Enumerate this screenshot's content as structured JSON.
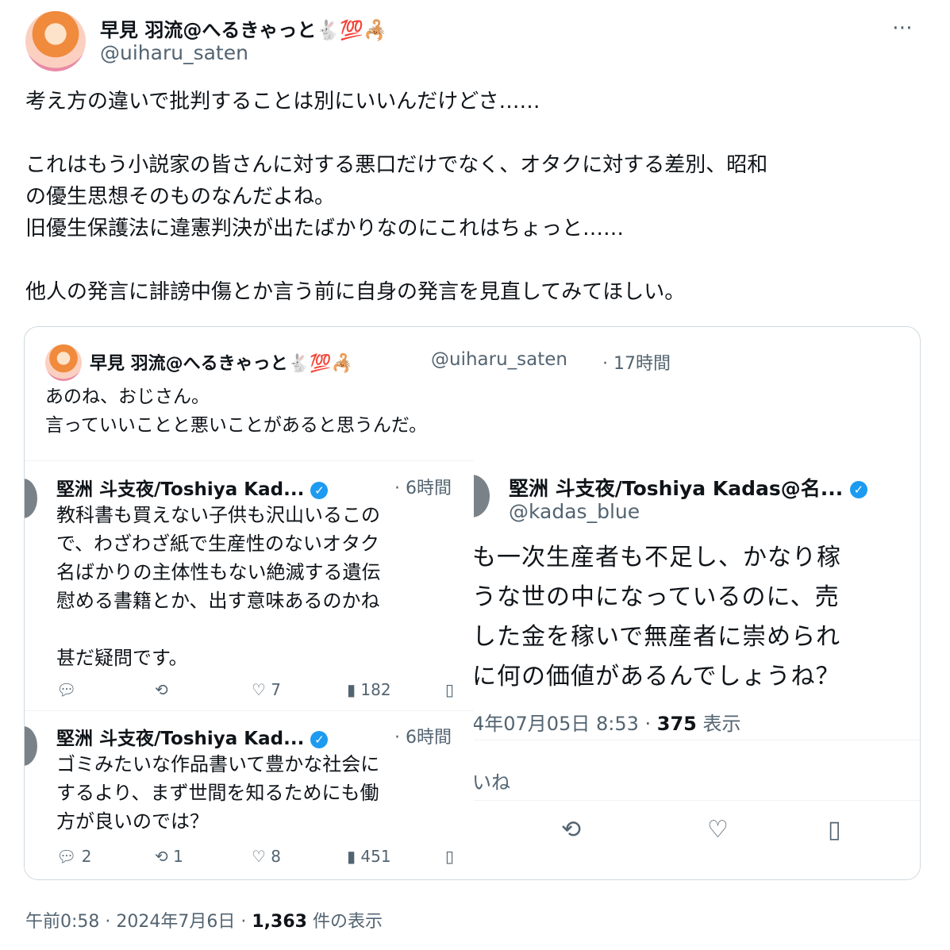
{
  "post": {
    "author_name": "早見 羽流@へるきゃっと🐇💯🦂",
    "author_handle": "@uiharu_saten",
    "more_icon": "⋯",
    "text_lines": [
      "考え方の違いで批判することは別にいいんだけどさ……",
      "",
      "これはもう小説家の皆さんに対する悪口だけでなく、オタクに対する差別、昭和",
      "の優生思想そのものなんだよね。",
      "旧優生保護法に違憲判決が出たばかりなのにこれはちょっと……",
      "",
      "他人の発言に誹謗中傷とか言う前に自身の発言を見直してみてほしい。"
    ],
    "footer": {
      "time": "午前0:58",
      "date": "2024年7月6日",
      "views_count": "1,363",
      "views_label": "件の表示"
    }
  },
  "quote": {
    "author_name": "早見 羽流@へるきゃっと🐇💯🦂",
    "author_handle": "@uiharu_saten",
    "time": "· 17時間",
    "text_lines": [
      "あのね、おじさん。",
      "言っていいことと悪いことがあると思うんだ。"
    ]
  },
  "left_panel": {
    "tweets": [
      {
        "author": "堅洲 斗支夜/Toshiya Kad...",
        "time": "· 6時間",
        "lines": [
          "教科書も買えない子供も沢山いるこの",
          "で、わざわざ紙で生産性のないオタク",
          "名ばかりの主体性もない絶滅する遺伝",
          "慰める書籍とか、出す意味あるのかね",
          "",
          "甚だ疑問です。"
        ],
        "replies": "",
        "retweets": "",
        "likes": "7",
        "views": "182"
      },
      {
        "author": "堅洲 斗支夜/Toshiya Kad...",
        "time": "· 6時間",
        "lines": [
          "ゴミみたいな作品書いて豊かな社会に",
          "するより、まず世間を知るためにも働",
          "方が良いのでは？"
        ],
        "replies": "2",
        "retweets": "1",
        "likes": "8",
        "views": "451"
      }
    ]
  },
  "right_panel": {
    "author": "堅洲 斗支夜/Toshiya Kadas@名...",
    "handle": "@kadas_blue",
    "lines": [
      "も一次生産者も不足し、かなり稼",
      "うな世の中になっているのに、売",
      "した金を稼いで無産者に崇められ",
      "に何の価値があるんでしょうね？"
    ],
    "meta_datetime": "4年07月05日 8:53 · ",
    "meta_views": "375",
    "meta_views_label": " 表示",
    "likes_text": "いね"
  },
  "icons": {
    "reply": "reply-icon",
    "retweet": "retweet-icon",
    "like": "heart-icon",
    "views": "views-icon",
    "bookmark": "bookmark-icon",
    "verified": "verified-badge-icon"
  },
  "colors": {
    "text": "#0f1419",
    "secondary": "#536471",
    "border": "#cfd9de",
    "verified": "#1d9bf0"
  }
}
